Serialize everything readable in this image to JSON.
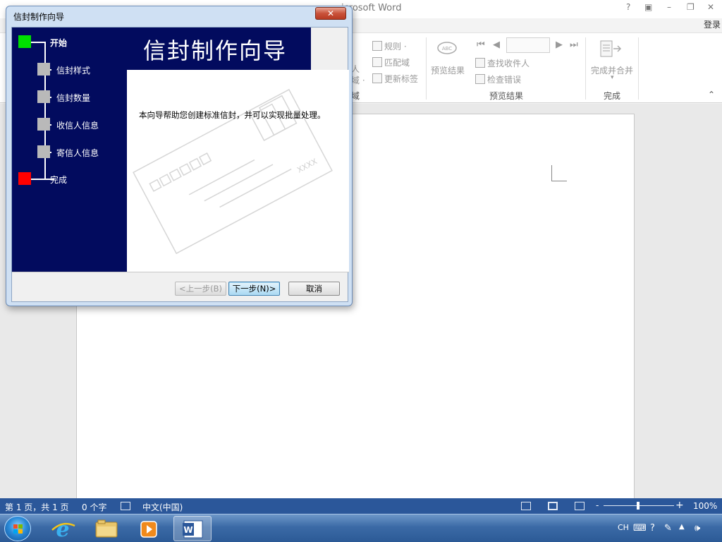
{
  "word_window": {
    "title": "icrosoft Word",
    "help": "?",
    "ribbon_display": "▣",
    "minimize": "–",
    "restore": "❐",
    "close": "✕",
    "sign_in": "登录"
  },
  "ribbon": {
    "partial_left_top": "人",
    "partial_left_bottom": "域 ·",
    "partial_group_label": "域",
    "rules": "规则 ·",
    "match_fields": "匹配域",
    "update_labels": "更新标签",
    "preview_results": "预览结果",
    "find_recipient": "查找收件人",
    "check_errors": "检查错误",
    "group_preview": "预览结果",
    "finish_merge": "完成并合并",
    "finish_merge_arrow": "▾",
    "group_finish": "完成",
    "collapse": "⌃",
    "nav_first": "⏮",
    "nav_prev": "◀",
    "nav_next": "▶",
    "nav_last": "⏭"
  },
  "statusbar": {
    "page": "第 1 页，共 1 页",
    "words": "0 个字",
    "language": "中文(中国)",
    "zoom_minus": "-",
    "zoom_plus": "+",
    "zoom_level": "100%",
    "zoom_fraction": 0.5
  },
  "taskbar": {
    "apps": [
      "start-button",
      "internet-explorer",
      "file-explorer",
      "media-player",
      "word"
    ],
    "active_app": "word",
    "tray_lang": "CH",
    "tray_help": "?"
  },
  "dialog": {
    "title": "信封制作向导",
    "close": "✕",
    "banner": "信封制作向导",
    "steps": [
      {
        "label": "开始",
        "state": "current",
        "color": "#00e000"
      },
      {
        "label": "信封样式",
        "state": "pending",
        "color": "#b9b9b9"
      },
      {
        "label": "信封数量",
        "state": "pending",
        "color": "#b9b9b9"
      },
      {
        "label": "收信人信息",
        "state": "pending",
        "color": "#b9b9b9"
      },
      {
        "label": "寄信人信息",
        "state": "pending",
        "color": "#b9b9b9"
      },
      {
        "label": "完成",
        "state": "final",
        "color": "#ff0000"
      }
    ],
    "intro": "本向导帮助您创建标准信封，并可以实现批量处理。",
    "envelope_marks": "XXXX",
    "buttons": {
      "back": "<上一步(B)",
      "next": "下一步(N)>",
      "cancel": "取消"
    }
  },
  "colors": {
    "wizard_navy": "#020b5e",
    "statusbar_blue": "#2b579a"
  }
}
